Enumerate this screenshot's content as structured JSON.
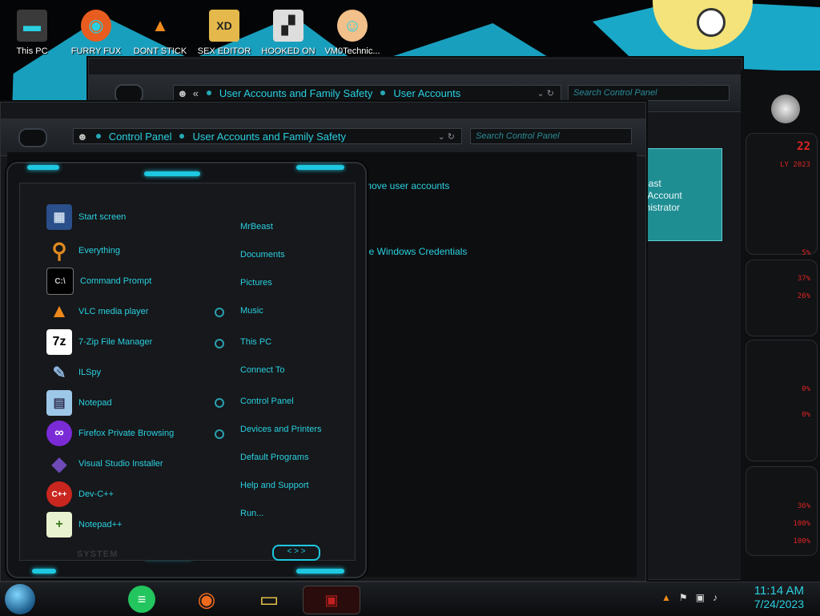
{
  "desktop": {
    "icons": [
      {
        "label": "This PC",
        "icon": "this-pc-icon",
        "color": "#444"
      },
      {
        "label": "FURRY FUX",
        "icon": "firefox-icon",
        "color": "#e85d1f"
      },
      {
        "label": "DONT STICK",
        "icon": "vlc-icon",
        "color": "#f08a1c"
      },
      {
        "label": "SEX EDITOR",
        "icon": "editor-icon",
        "color": "#e4b84a"
      },
      {
        "label": "HOOKED ON",
        "icon": "hooked-icon",
        "color": "#777"
      },
      {
        "label": "VM0Technic...",
        "icon": "doctor-icon",
        "color": "#f2c08a"
      }
    ]
  },
  "back_window": {
    "breadcrumb": [
      "User Accounts and Family Safety",
      "User Accounts"
    ],
    "search_placeholder": "Search Control Panel",
    "nav_back": "«"
  },
  "front_window": {
    "breadcrumb": [
      "Control Panel",
      "User Accounts and Family Safety"
    ],
    "search_placeholder": "Search Control Panel",
    "tasks": [
      "move user accounts",
      "r",
      "ge Windows Credentials"
    ]
  },
  "account_box": {
    "line1": "east",
    "line2": "l Account",
    "line3": "inistrator"
  },
  "sidebar_readouts": {
    "top": "22",
    "date": "LY 2023",
    "values": [
      "5%",
      "37%",
      "26%",
      "0%",
      "0%",
      "36%",
      "100%",
      "100%"
    ]
  },
  "start_menu": {
    "programs": [
      {
        "label": "Start screen",
        "icon": "start-screen-icon",
        "glyph": "▦",
        "color": "#2a4f8a"
      },
      {
        "label": "Everything",
        "icon": "everything-search-icon",
        "glyph": "⚲",
        "color": "#e08a20"
      },
      {
        "label": "Command Prompt",
        "icon": "command-prompt-icon",
        "glyph": "C:\\",
        "color": "#111"
      },
      {
        "label": "VLC media player",
        "icon": "vlc-icon",
        "glyph": "▲",
        "color": "#f08a1c"
      },
      {
        "label": "7-Zip File Manager",
        "icon": "7zip-icon",
        "glyph": "7z",
        "color": "#fff"
      },
      {
        "label": "ILSpy",
        "icon": "ilspy-icon",
        "glyph": "✎",
        "color": "#8fb8e0"
      },
      {
        "label": "Notepad",
        "icon": "notepad-icon",
        "glyph": "▤",
        "color": "#9ec8e8"
      },
      {
        "label": "Firefox Private Browsing",
        "icon": "firefox-private-icon",
        "glyph": "∞",
        "color": "#7b2bd6"
      },
      {
        "label": "Visual Studio Installer",
        "icon": "visual-studio-icon",
        "glyph": "◆",
        "color": "#6e4ab8"
      },
      {
        "label": "Dev-C++",
        "icon": "devcpp-icon",
        "glyph": "C++",
        "color": "#c8261e"
      },
      {
        "label": "Notepad++",
        "icon": "notepadpp-icon",
        "glyph": "+",
        "color": "#b6d86a"
      }
    ],
    "places": [
      {
        "label": "MrBeast",
        "pinned": false
      },
      {
        "label": "Documents",
        "pinned": false
      },
      {
        "label": "Pictures",
        "pinned": false
      },
      {
        "label": "Music",
        "pinned": true
      },
      {
        "label": "This PC",
        "pinned": true
      },
      {
        "label": "Connect To",
        "pinned": false
      },
      {
        "label": "Control Panel",
        "pinned": true
      },
      {
        "label": "Devices and Printers",
        "pinned": true
      },
      {
        "label": "Default Programs",
        "pinned": false
      },
      {
        "label": "Help and Support",
        "pinned": false
      },
      {
        "label": "Run...",
        "pinned": false
      }
    ],
    "system_label": "SYSTEM",
    "pager": "< > >"
  },
  "taskbar": {
    "apps": [
      {
        "name": "notes-app-icon",
        "glyph": "≡",
        "color": "#22c55e"
      },
      {
        "name": "firefox-icon",
        "glyph": "◉",
        "color": "#f06a1c"
      },
      {
        "name": "file-explorer-icon",
        "glyph": "▭",
        "color": "#f2c94c"
      },
      {
        "name": "active-window-icon",
        "glyph": "▣",
        "color": "#c02020"
      }
    ],
    "time": "11:14 AM",
    "date": "7/24/2023"
  }
}
